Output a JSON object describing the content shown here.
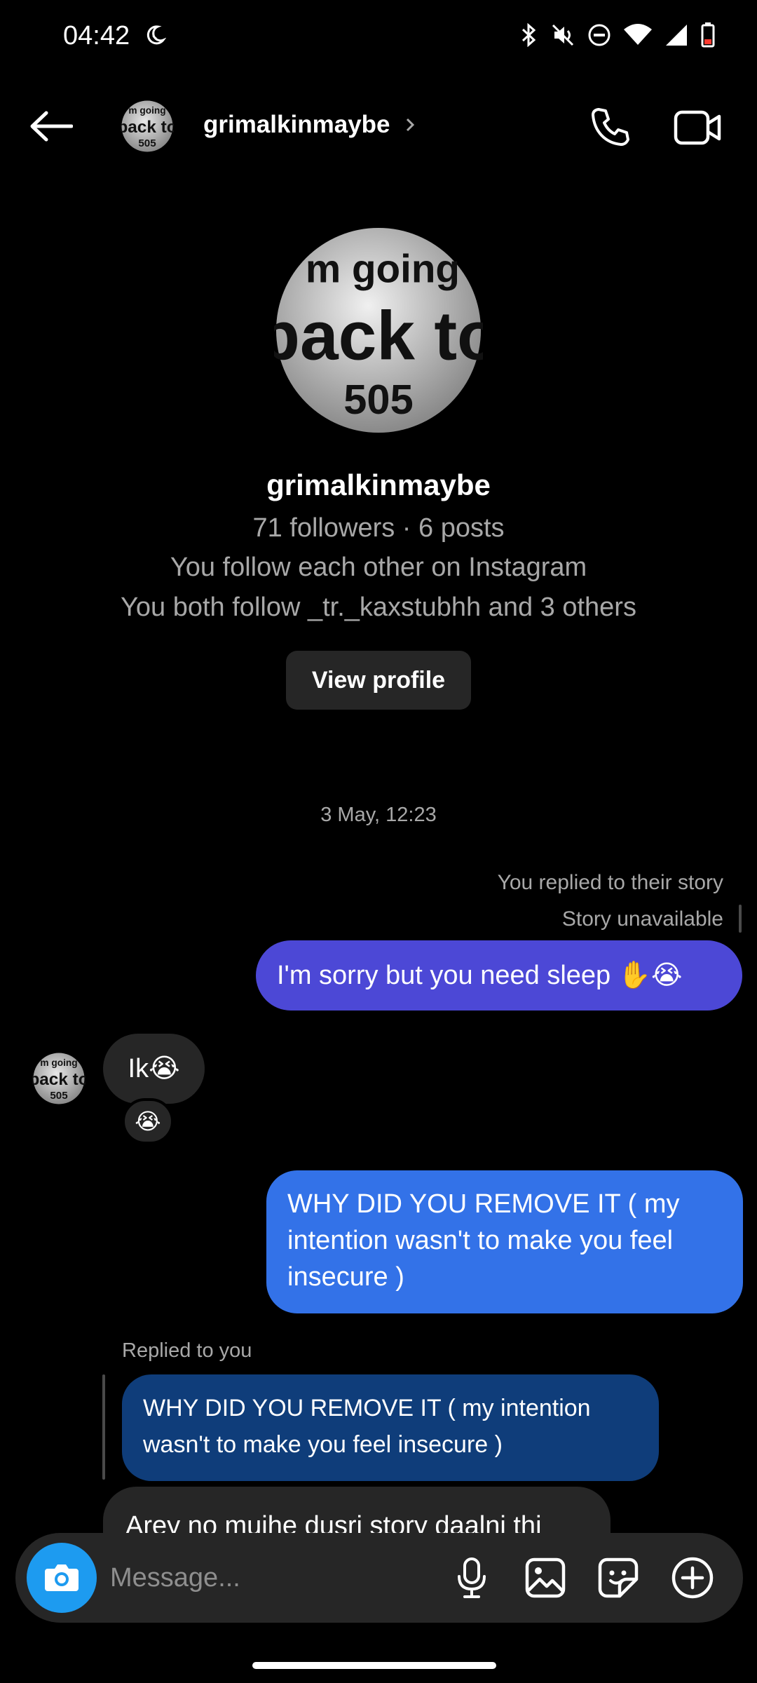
{
  "status_bar": {
    "time": "04:42",
    "icons": [
      "moon-icon",
      "bluetooth-icon",
      "mute-icon",
      "dnd-icon",
      "wifi-icon",
      "signal-icon",
      "battery-low-icon"
    ]
  },
  "header": {
    "username": "grimalkinmaybe"
  },
  "avatar_art": {
    "line1": "m going",
    "line2": "back to",
    "line3": "505"
  },
  "profile": {
    "name": "grimalkinmaybe",
    "stats": "71 followers · 6 posts",
    "follow_status": "You follow each other on Instagram",
    "mutuals": "You both follow _tr._kaxstubhh and 3 others",
    "view_profile_label": "View profile"
  },
  "conversation": {
    "timestamp": "3 May, 12:23",
    "story_reply_label": "You replied to their story",
    "story_unavailable": "Story unavailable",
    "messages": [
      {
        "from": "me",
        "text": "I'm sorry but you need sleep ✋😭"
      },
      {
        "from": "them",
        "text": "Ik😭",
        "reaction": "😭"
      },
      {
        "from": "me",
        "text": "WHY DID YOU REMOVE IT ( my intention wasn't to make you feel insecure )"
      },
      {
        "from": "them",
        "replied_label": "Replied to you",
        "quoted": "WHY DID YOU REMOVE IT ( my intention wasn't to make you feel insecure )",
        "text": "Arey no mujhe dusri story daalni thi"
      }
    ]
  },
  "composer": {
    "placeholder": "Message..."
  },
  "colors": {
    "background": "#000000",
    "sent_bubble_purple": "#4c48d6",
    "sent_bubble_blue": "#3372e8",
    "quoted_bubble": "#0f3d7a",
    "received_bubble": "#262626",
    "camera_button": "#1d9bf0"
  }
}
